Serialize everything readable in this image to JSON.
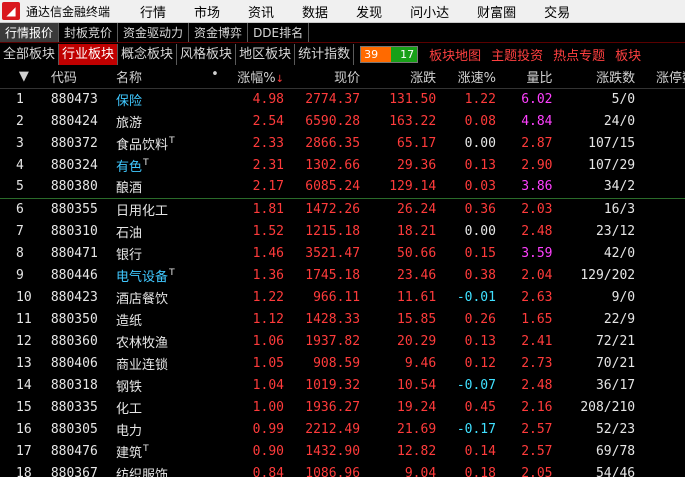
{
  "titlebar": {
    "app_title": "通达信金融终端",
    "menu": [
      "行情",
      "市场",
      "资讯",
      "数据",
      "发现",
      "问小达",
      "财富圈",
      "交易"
    ]
  },
  "subtabs": [
    "行情报价",
    "封板竞价",
    "资金驱动力",
    "资金博弈",
    "DDE排名"
  ],
  "cattabs": [
    "全部板块",
    "行业板块",
    "概念板块",
    "风格板块",
    "地区板块",
    "统计指数"
  ],
  "counter": {
    "up": "39",
    "down": "17"
  },
  "redlinks": [
    "板块地图",
    "主题投资",
    "热点专题",
    "板块"
  ],
  "colors": {
    "up": "#ff3b3b",
    "down": "#40e0ff",
    "accent": "#c00000"
  },
  "table": {
    "headers": {
      "idx": "",
      "code": "代码",
      "name": "名称",
      "dot": "•",
      "pct": "涨幅%",
      "price": "现价",
      "chg": "涨跌",
      "speed": "涨速%",
      "vol_ratio": "量比",
      "updown": "涨跌数",
      "limit": "涨停数"
    },
    "rows": [
      {
        "idx": "1",
        "code": "880473",
        "name": "保险",
        "t": "",
        "hl": true,
        "pct": "4.98",
        "price": "2774.37",
        "chg": "131.50",
        "speed": "1.22",
        "vr": "6.02",
        "vr_c": "magenta",
        "ud": "5/0"
      },
      {
        "idx": "2",
        "code": "880424",
        "name": "旅游",
        "t": "",
        "hl": false,
        "pct": "2.54",
        "price": "6590.28",
        "chg": "163.22",
        "speed": "0.08",
        "vr": "4.84",
        "vr_c": "magenta",
        "ud": "24/0"
      },
      {
        "idx": "3",
        "code": "880372",
        "name": "食品饮料",
        "t": "T",
        "hl": false,
        "pct": "2.33",
        "price": "2866.35",
        "chg": "65.17",
        "speed": "0.00",
        "vr": "2.87",
        "vr_c": "red",
        "ud": "107/15"
      },
      {
        "idx": "4",
        "code": "880324",
        "name": "有色",
        "t": "T",
        "hl": true,
        "pct": "2.31",
        "price": "1302.66",
        "chg": "29.36",
        "speed": "0.13",
        "vr": "2.90",
        "vr_c": "red",
        "ud": "107/29"
      },
      {
        "idx": "5",
        "code": "880380",
        "name": "酿酒",
        "t": "",
        "hl": false,
        "pct": "2.17",
        "price": "6085.24",
        "chg": "129.14",
        "speed": "0.03",
        "vr": "3.86",
        "vr_c": "magenta",
        "ud": "34/2"
      },
      {
        "idx": "6",
        "code": "880355",
        "name": "日用化工",
        "t": "",
        "hl": false,
        "pct": "1.81",
        "price": "1472.26",
        "chg": "26.24",
        "speed": "0.36",
        "vr": "2.03",
        "vr_c": "red",
        "ud": "16/3"
      },
      {
        "idx": "7",
        "code": "880310",
        "name": "石油",
        "t": "",
        "hl": false,
        "pct": "1.52",
        "price": "1215.18",
        "chg": "18.21",
        "speed": "0.00",
        "vr": "2.48",
        "vr_c": "red",
        "ud": "23/12"
      },
      {
        "idx": "8",
        "code": "880471",
        "name": "银行",
        "t": "",
        "hl": false,
        "pct": "1.46",
        "price": "3521.47",
        "chg": "50.66",
        "speed": "0.15",
        "vr": "3.59",
        "vr_c": "magenta",
        "ud": "42/0"
      },
      {
        "idx": "9",
        "code": "880446",
        "name": "电气设备",
        "t": "T",
        "hl": true,
        "pct": "1.36",
        "price": "1745.18",
        "chg": "23.46",
        "speed": "0.38",
        "vr": "2.04",
        "vr_c": "red",
        "ud": "129/202"
      },
      {
        "idx": "10",
        "code": "880423",
        "name": "酒店餐饮",
        "t": "",
        "hl": false,
        "pct": "1.22",
        "price": "966.11",
        "chg": "11.61",
        "speed": "-0.01",
        "vr": "2.63",
        "vr_c": "red",
        "ud": "9/0"
      },
      {
        "idx": "11",
        "code": "880350",
        "name": "造纸",
        "t": "",
        "hl": false,
        "pct": "1.12",
        "price": "1428.33",
        "chg": "15.85",
        "speed": "0.26",
        "vr": "1.65",
        "vr_c": "red",
        "ud": "22/9"
      },
      {
        "idx": "12",
        "code": "880360",
        "name": "农林牧渔",
        "t": "",
        "hl": false,
        "pct": "1.06",
        "price": "1937.82",
        "chg": "20.29",
        "speed": "0.13",
        "vr": "2.41",
        "vr_c": "red",
        "ud": "72/21"
      },
      {
        "idx": "13",
        "code": "880406",
        "name": "商业连锁",
        "t": "",
        "hl": false,
        "pct": "1.05",
        "price": "908.59",
        "chg": "9.46",
        "speed": "0.12",
        "vr": "2.73",
        "vr_c": "red",
        "ud": "70/21"
      },
      {
        "idx": "14",
        "code": "880318",
        "name": "钢铁",
        "t": "",
        "hl": false,
        "pct": "1.04",
        "price": "1019.32",
        "chg": "10.54",
        "speed": "-0.07",
        "vr": "2.48",
        "vr_c": "red",
        "ud": "36/17"
      },
      {
        "idx": "15",
        "code": "880335",
        "name": "化工",
        "t": "",
        "hl": false,
        "pct": "1.00",
        "price": "1936.27",
        "chg": "19.24",
        "speed": "0.45",
        "vr": "2.16",
        "vr_c": "red",
        "ud": "208/210"
      },
      {
        "idx": "16",
        "code": "880305",
        "name": "电力",
        "t": "",
        "hl": false,
        "pct": "0.99",
        "price": "2212.49",
        "chg": "21.69",
        "speed": "-0.17",
        "vr": "2.57",
        "vr_c": "red",
        "ud": "52/23"
      },
      {
        "idx": "17",
        "code": "880476",
        "name": "建筑",
        "t": "T",
        "hl": false,
        "pct": "0.90",
        "price": "1432.90",
        "chg": "12.82",
        "speed": "0.14",
        "vr": "2.57",
        "vr_c": "red",
        "ud": "69/78"
      },
      {
        "idx": "18",
        "code": "880367",
        "name": "纺织服饰",
        "t": "",
        "hl": false,
        "pct": "0.84",
        "price": "1086.96",
        "chg": "9.04",
        "speed": "0.18",
        "vr": "2.05",
        "vr_c": "red",
        "ud": "54/46"
      }
    ]
  }
}
